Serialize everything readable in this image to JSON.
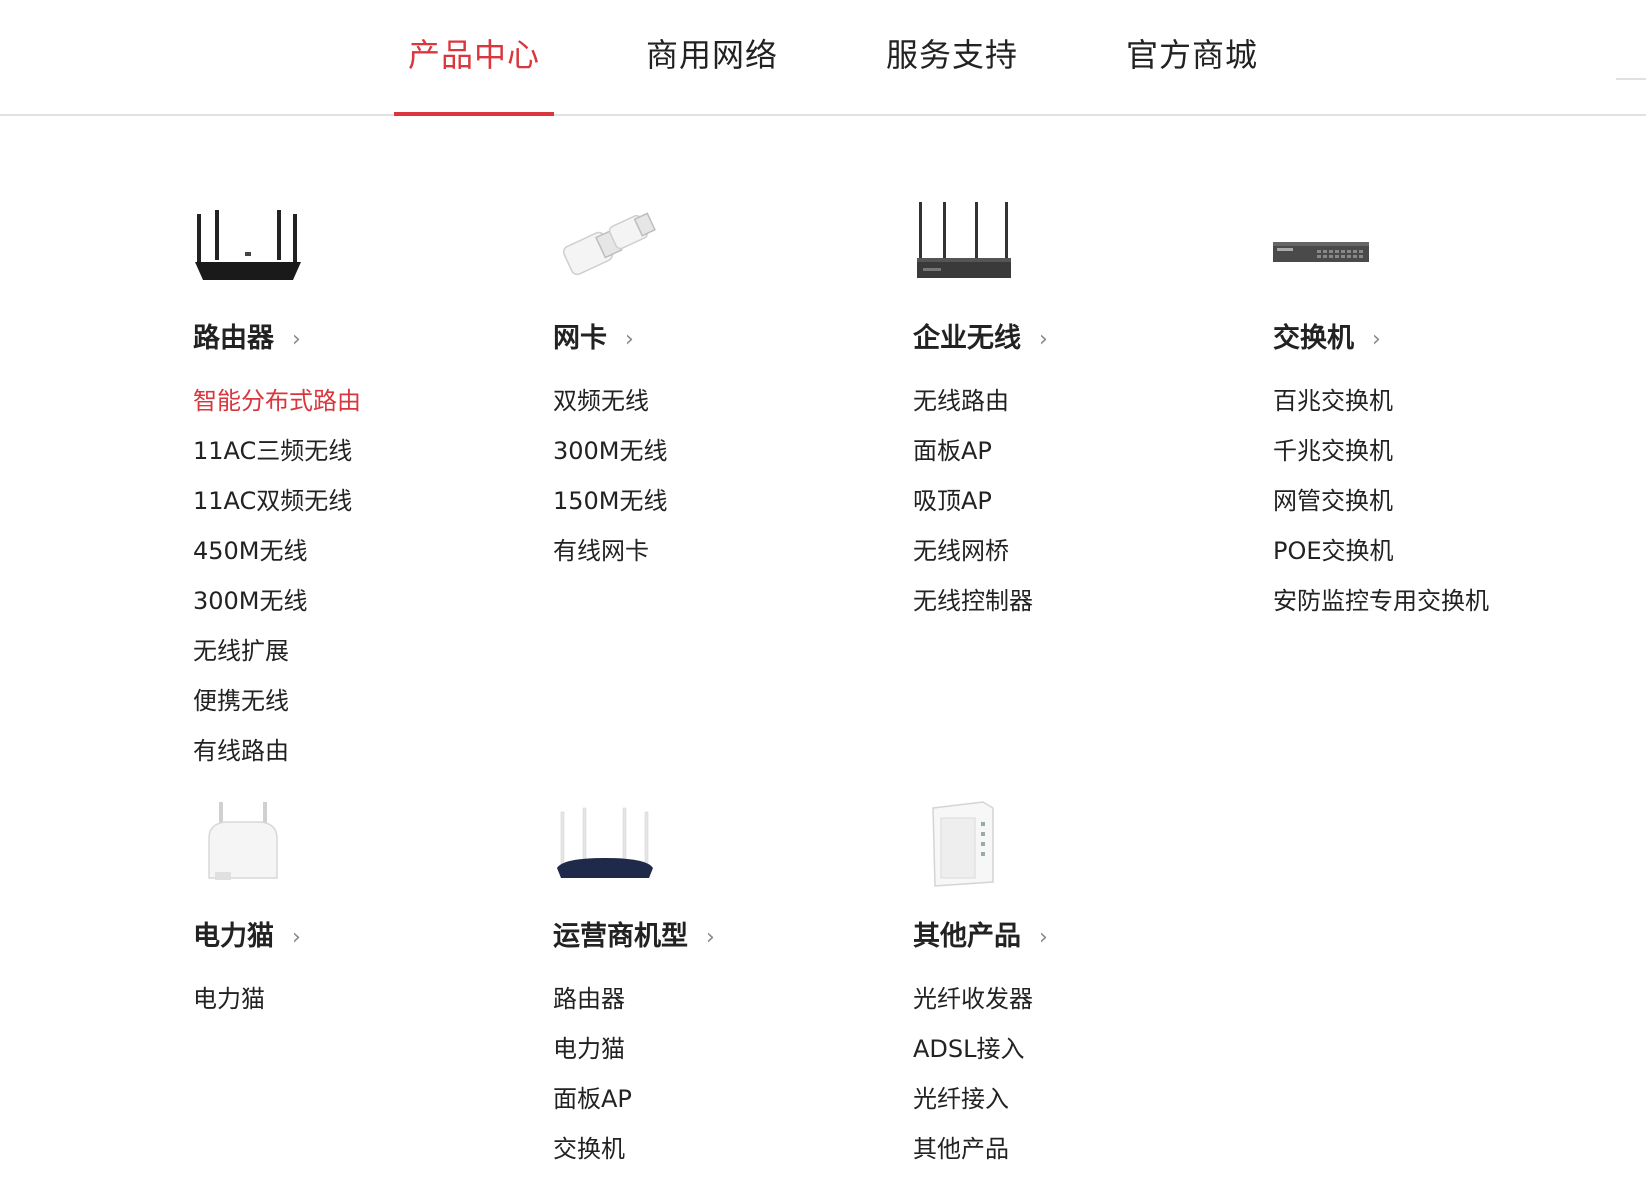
{
  "nav": {
    "tabs": [
      {
        "label": "产品中心",
        "active": true
      },
      {
        "label": "商用网络",
        "active": false
      },
      {
        "label": "服务支持",
        "active": false
      },
      {
        "label": "官方商城",
        "active": false
      }
    ]
  },
  "categories": [
    {
      "title": "路由器",
      "icon": "router-image",
      "items": [
        "智能分布式路由",
        "11AC三频无线",
        "11AC双频无线",
        "450M无线",
        "300M无线",
        "无线扩展",
        "便携无线",
        "有线路由"
      ]
    },
    {
      "title": "网卡",
      "icon": "usb-adapter-image",
      "items": [
        "双频无线",
        "300M无线",
        "150M无线",
        "有线网卡"
      ]
    },
    {
      "title": "企业无线",
      "icon": "enterprise-router-image",
      "items": [
        "无线路由",
        "面板AP",
        "吸顶AP",
        "无线网桥",
        "无线控制器"
      ]
    },
    {
      "title": "交换机",
      "icon": "switch-image",
      "items": [
        "百兆交换机",
        "千兆交换机",
        "网管交换机",
        "POE交换机",
        "安防监控专用交换机"
      ]
    },
    {
      "title": "电力猫",
      "icon": "powerline-adapter-image",
      "items": [
        "电力猫"
      ]
    },
    {
      "title": "运营商机型",
      "icon": "carrier-router-image",
      "items": [
        "路由器",
        "电力猫",
        "面板AP",
        "交换机"
      ]
    },
    {
      "title": "其他产品",
      "icon": "fiber-converter-image",
      "items": [
        "光纤收发器",
        "ADSL接入",
        "光纤接入",
        "其他产品"
      ]
    }
  ],
  "colors": {
    "accent": "#d9363e",
    "text": "#222222",
    "divider": "#e1e1e1"
  },
  "highlighted_item": "智能分布式路由",
  "chevron": "chevron-right-icon"
}
